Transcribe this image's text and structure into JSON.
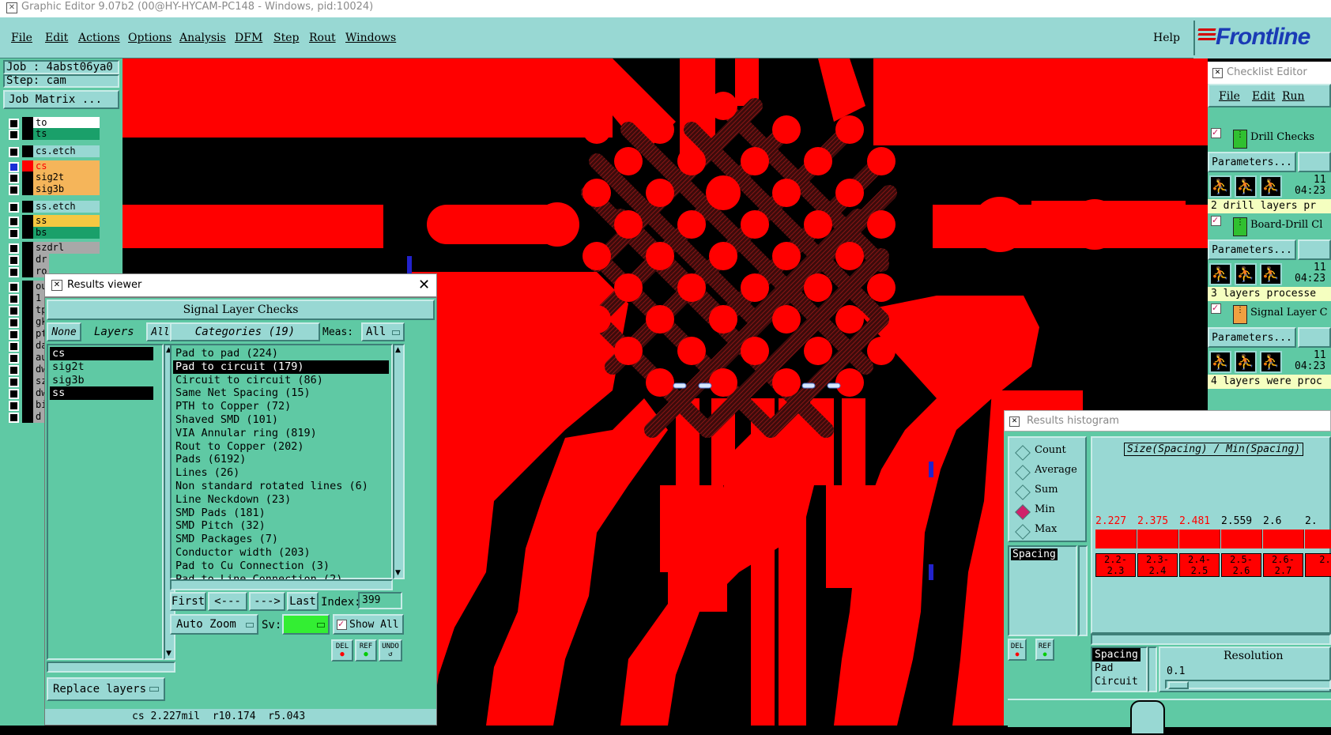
{
  "window": {
    "title": "Graphic Editor 9.07b2 (00@HY-HYCAM-PC148 - Windows, pid:10024)"
  },
  "menubar": {
    "items": [
      "File",
      "Edit",
      "Actions",
      "Options",
      "Analysis",
      "DFM",
      "Step",
      "Rout",
      "Windows"
    ],
    "help": "Help",
    "logo_text": "Frontline"
  },
  "left_panel": {
    "job": "Job : 4abst06ya0",
    "step": "Step: cam",
    "job_matrix": "Job Matrix ...",
    "layers": [
      {
        "name": "to",
        "bg": "#ffffff"
      },
      {
        "name": "ts",
        "bg": "#1aa06a"
      },
      {
        "name": "cs.etch",
        "bg": "#98d8d3"
      },
      {
        "name": "cs",
        "bg": "#f5b55a",
        "color": "#ff0000"
      },
      {
        "name": "sig2t",
        "bg": "#f5b55a"
      },
      {
        "name": "sig3b",
        "bg": "#f5b55a"
      },
      {
        "name": "ss.etch",
        "bg": "#98d8d3"
      },
      {
        "name": "ss",
        "bg": "#f5c842"
      },
      {
        "name": "bs",
        "bg": "#1aa06a"
      },
      {
        "name": "szdrl",
        "bg": "#a8a8a8"
      },
      {
        "name": "dr",
        "bg": "#a8a8a8"
      },
      {
        "name": "ro",
        "bg": "#a8a8a8"
      },
      {
        "name": "ou",
        "bg": "#a8a8a8"
      },
      {
        "name": "1",
        "bg": "#a8a8a8"
      },
      {
        "name": "tp",
        "bg": "#a8a8a8"
      },
      {
        "name": "gk",
        "bg": "#a8a8a8"
      },
      {
        "name": "pt",
        "bg": "#a8a8a8"
      },
      {
        "name": "da",
        "bg": "#a8a8a8"
      },
      {
        "name": "au",
        "bg": "#a8a8a8"
      },
      {
        "name": "dw",
        "bg": "#a8a8a8"
      },
      {
        "name": "sz",
        "bg": "#a8a8a8"
      },
      {
        "name": "dw",
        "bg": "#a8a8a8"
      },
      {
        "name": "bi",
        "bg": "#a8a8a8"
      },
      {
        "name": "d",
        "bg": "#a8a8a8"
      }
    ]
  },
  "results_viewer": {
    "title": "Results viewer",
    "header": "Signal Layer Checks",
    "none_btn": "None",
    "layers_label": "Layers",
    "all_btn": "All",
    "layers": [
      "cs",
      "sig2t",
      "sig3b",
      "ss"
    ],
    "selected_layers": [
      0,
      3
    ],
    "categories_label": "Categories (19)",
    "meas_label": "Meas:",
    "meas_value": "All",
    "categories": [
      "Pad to pad (224)",
      "Pad to circuit (179)",
      "Circuit to circuit (86)",
      "Same Net Spacing (15)",
      "PTH to Copper (72)",
      "Shaved SMD (101)",
      "VIA Annular ring (819)",
      "Rout to Copper (202)",
      "Pads (6192)",
      "Lines (26)",
      "Non standard rotated lines (6)",
      "Line Neckdown (23)",
      "SMD Pads (181)",
      "SMD Pitch (32)",
      "SMD Packages (7)",
      "Conductor width (203)",
      "Pad to Cu Connection (3)",
      "Pad to Line Connection (2)"
    ],
    "selected_category": 1,
    "first_btn": "First",
    "prev_btn": "<---",
    "next_btn": "--->",
    "last_btn": "Last",
    "index_label": "Index:",
    "index_value": "399",
    "auto_zoom": "Auto Zoom",
    "sv_label": "Sv:",
    "show_all": "Show All",
    "replace_layers": "Replace layers",
    "del": "DEL",
    "ref": "REF",
    "undo": "UNDO",
    "status": "cs 2.227mil  r10.174  r5.043"
  },
  "checklist": {
    "title": "Checklist Editor",
    "menu": [
      "File",
      "Edit",
      "Run"
    ],
    "sections": [
      {
        "name": "Drill Checks",
        "params": "Parameters...",
        "time": "04:23",
        "num": "11",
        "status": "2 drill layers pr"
      },
      {
        "name": "Board-Drill Cl",
        "params": "Parameters...",
        "time": "04:23",
        "num": "11",
        "status": "3 layers processe"
      },
      {
        "name": "Signal Layer C",
        "params": "Parameters...",
        "time": "04:23",
        "num": "11",
        "status": "4 layers were proc"
      }
    ]
  },
  "histogram": {
    "title": "Results histogram",
    "modes": [
      "Count",
      "Average",
      "Sum",
      "Min",
      "Max"
    ],
    "selected_mode": "Min",
    "chart_title": "Size(Spacing) / Min(Spacing)",
    "bar_values": [
      "2.227",
      "2.375",
      "2.481",
      "2.559",
      "2.6",
      "2."
    ],
    "bar_colors": [
      "#ff0000",
      "#ff0000",
      "#ff0000",
      "#000000",
      "#000000",
      "#000000"
    ],
    "bin_labels": [
      [
        "2.2-",
        "2.3"
      ],
      [
        "2.3-",
        "2.4"
      ],
      [
        "2.4-",
        "2.5"
      ],
      [
        "2.5-",
        "2.6"
      ],
      [
        "2.6-",
        "2.7"
      ],
      [
        "2.",
        ""
      ]
    ],
    "left_list": [
      "Spacing"
    ],
    "type_list": [
      "Spacing",
      "Pad",
      "Circuit"
    ],
    "resolution_label": "Resolution",
    "resolution_value": "0.1",
    "del": "DEL",
    "ref": "REF"
  }
}
